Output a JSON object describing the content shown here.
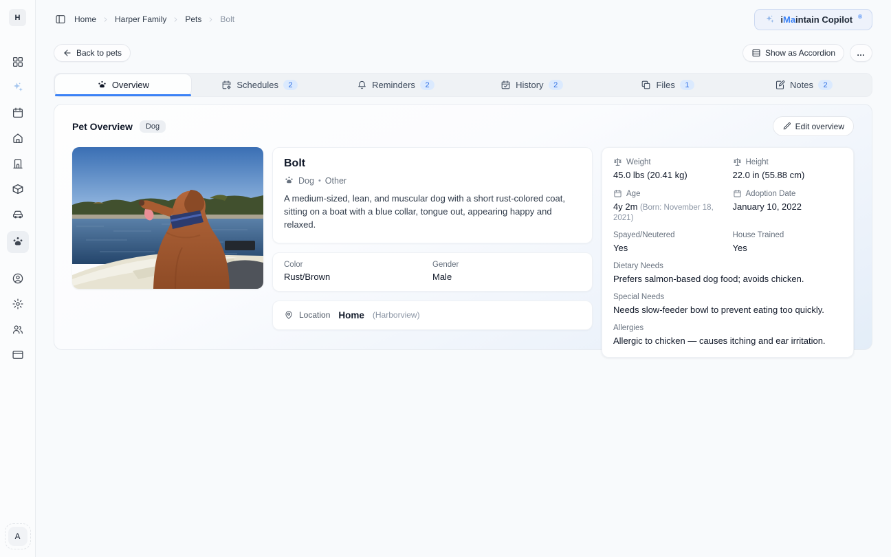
{
  "colors": {
    "accent": "#3b82f6",
    "badge_bg": "#dbeafe",
    "badge_text": "#2f6fe4",
    "active_underline": "#3b82f6"
  },
  "sidebar": {
    "workspace_avatar": "H",
    "user_avatar": "A",
    "items": [
      {
        "name": "dashboard-grid-icon"
      },
      {
        "name": "copilot-sparkles-icon"
      },
      {
        "name": "calendar-icon"
      },
      {
        "name": "home-icon"
      },
      {
        "name": "door-icon"
      },
      {
        "name": "package-icon"
      },
      {
        "name": "car-icon"
      },
      {
        "name": "pets-icon",
        "active": true
      },
      {
        "name": "account-icon"
      },
      {
        "name": "settings-icon"
      },
      {
        "name": "members-icon"
      },
      {
        "name": "billing-icon"
      }
    ]
  },
  "header": {
    "breadcrumb": [
      "Home",
      "Harper Family",
      "Pets",
      "Bolt"
    ],
    "copilot": {
      "prefix": "i",
      "accent": "Ma",
      "suffix": "intain Copilot",
      "sup": "®"
    }
  },
  "toolbar": {
    "back_label": "Back to pets",
    "accordion_label": "Show as Accordion",
    "more_label": "…"
  },
  "tabs": [
    {
      "label": "Overview",
      "active": true
    },
    {
      "label": "Schedules",
      "count": 2
    },
    {
      "label": "Reminders",
      "count": 2
    },
    {
      "label": "History",
      "count": 2
    },
    {
      "label": "Files",
      "count": 1
    },
    {
      "label": "Notes",
      "count": 2
    }
  ],
  "overview": {
    "title": "Pet Overview",
    "type_badge": "Dog",
    "edit_label": "Edit overview"
  },
  "pet": {
    "name": "Bolt",
    "species": "Dog",
    "breed": "Other",
    "separator": "•",
    "description": "A medium-sized, lean, and muscular dog with a short rust-colored coat, sitting on a boat with a blue collar, tongue out, appearing happy and relaxed.",
    "color_label": "Color",
    "color": "Rust/Brown",
    "gender_label": "Gender",
    "gender": "Male",
    "location_label": "Location",
    "location": "Home",
    "location_sub": "(Harborview)"
  },
  "stats": {
    "weight_label": "Weight",
    "weight": "45.0 lbs (20.41 kg)",
    "height_label": "Height",
    "height": "22.0 in (55.88 cm)",
    "age_label": "Age",
    "age": "4y 2m",
    "age_born": "(Born: November 18, 2021)",
    "adoption_label": "Adoption Date",
    "adoption": "January 10, 2022",
    "spayed_label": "Spayed/Neutered",
    "spayed": "Yes",
    "house_label": "House Trained",
    "house": "Yes",
    "dietary_label": "Dietary Needs",
    "dietary": "Prefers salmon-based dog food; avoids chicken.",
    "special_label": "Special Needs",
    "special": "Needs slow-feeder bowl to prevent eating too quickly.",
    "allergies_label": "Allergies",
    "allergies": "Allergic to chicken — causes itching and ear irritation."
  }
}
